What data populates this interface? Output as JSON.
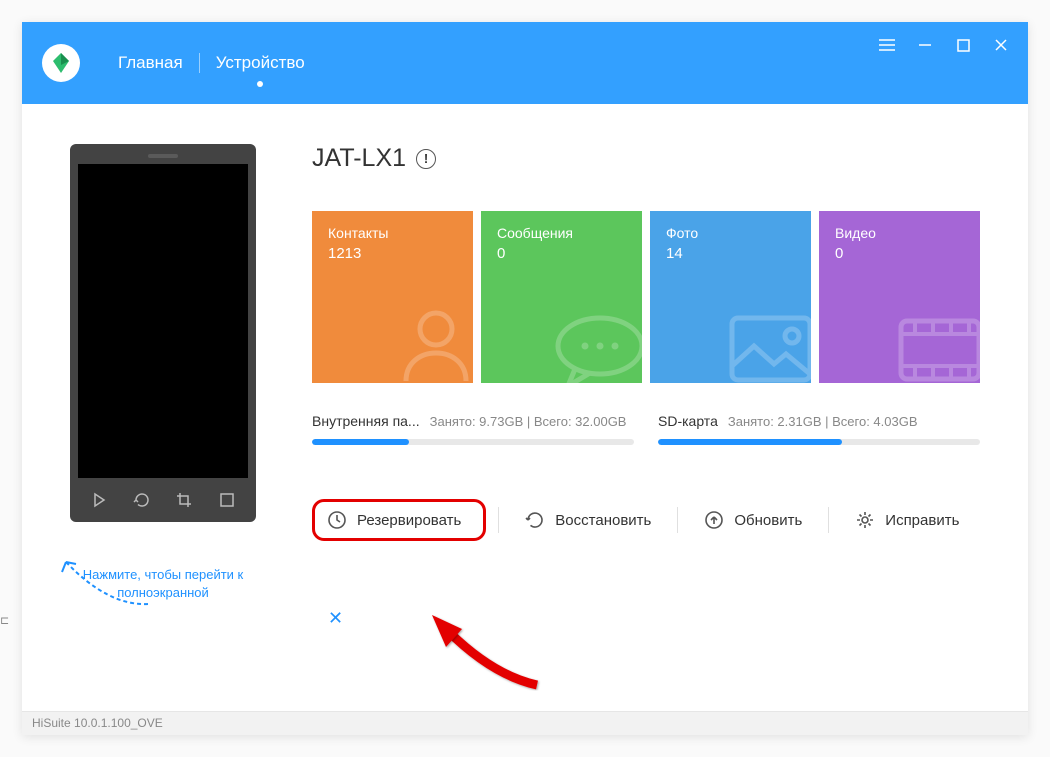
{
  "nav": {
    "home": "Главная",
    "device": "Устройство"
  },
  "device": {
    "name": "JAT-LX1"
  },
  "tiles": {
    "contacts": {
      "label": "Контакты",
      "count": "1213"
    },
    "messages": {
      "label": "Сообщения",
      "count": "0"
    },
    "photos": {
      "label": "Фото",
      "count": "14"
    },
    "videos": {
      "label": "Видео",
      "count": "0"
    }
  },
  "storage": {
    "internal": {
      "name": "Внутренняя па...",
      "info": "Занято: 9.73GB | Всего: 32.00GB",
      "percent": 30
    },
    "sd": {
      "name": "SD-карта",
      "info": "Занято: 2.31GB | Всего: 4.03GB",
      "percent": 57
    }
  },
  "actions": {
    "backup": "Резервировать",
    "restore": "Восстановить",
    "update": "Обновить",
    "fix": "Исправить"
  },
  "hint": "Нажмите, чтобы перейти к полноэкранной",
  "footer": "HiSuite 10.0.1.100_OVE"
}
